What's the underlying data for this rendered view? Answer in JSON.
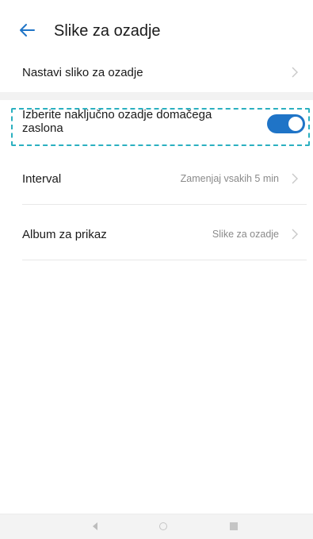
{
  "app": {
    "title": "Slike za ozadje"
  },
  "settings": {
    "set_wallpaper": {
      "label": "Nastavi sliko za ozadje"
    },
    "random_wallpaper": {
      "label": "Izberite naključno ozadje domačega zaslona",
      "enabled": true
    },
    "interval": {
      "label": "Interval",
      "value": "Zamenjaj vsakih 5 min"
    },
    "album": {
      "label": "Album za prikaz",
      "value": "Slike za ozadje"
    }
  },
  "colors": {
    "accent": "#1f74c7",
    "highlight_border": "#2bb0c0"
  },
  "icons": {
    "back": "arrow-left-icon",
    "chevron": "chevron-right-icon",
    "nav_back": "triangle-left-icon",
    "nav_home": "circle-icon",
    "nav_recent": "square-icon"
  }
}
